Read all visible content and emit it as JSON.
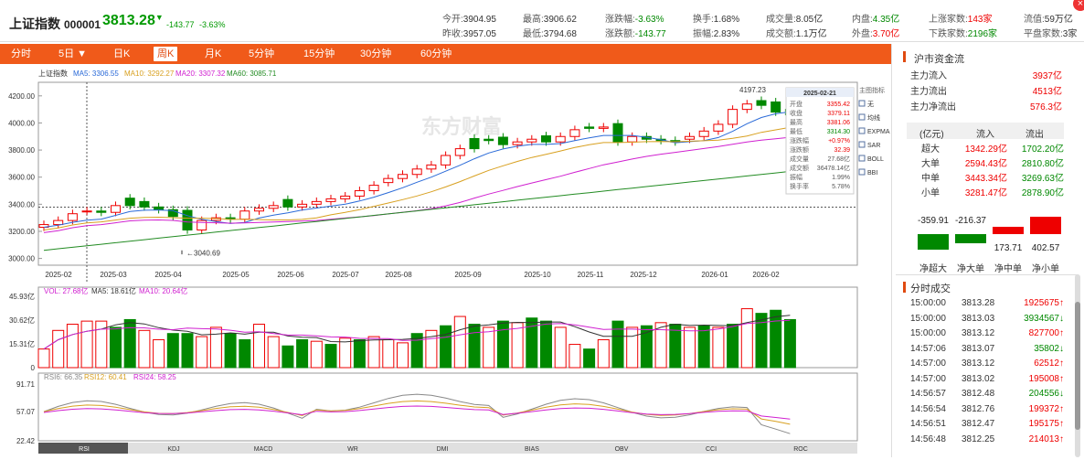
{
  "header": {
    "name": "上证指数",
    "code": "000001",
    "price": "3813.28",
    "arrow": "▼",
    "change": "-143.77",
    "change_pct": "-3.63%"
  },
  "stats": [
    {
      "k": "今开:",
      "v": "3904.95",
      "c": "nt"
    },
    {
      "k": "最高:",
      "v": "3906.62",
      "c": "nt"
    },
    {
      "k": "涨跌幅:",
      "v": "-3.63%",
      "c": "dn"
    },
    {
      "k": "换手:",
      "v": "1.68%",
      "c": "nt"
    },
    {
      "k": "成交量:",
      "v": "8.05亿",
      "c": "nt"
    },
    {
      "k": "内盘:",
      "v": "4.35亿",
      "c": "dn"
    },
    {
      "k": "上涨家数:",
      "v": "143家",
      "c": "up"
    },
    {
      "k": "流值:",
      "v": "59万亿",
      "c": "nt"
    },
    {
      "k": "昨收:",
      "v": "3957.05",
      "c": "nt"
    },
    {
      "k": "最低:",
      "v": "3794.68",
      "c": "nt"
    },
    {
      "k": "涨跌额:",
      "v": "-143.77",
      "c": "dn"
    },
    {
      "k": "振幅:",
      "v": "2.83%",
      "c": "nt"
    },
    {
      "k": "成交额:",
      "v": "1.1万亿",
      "c": "nt"
    },
    {
      "k": "外盘:",
      "v": "3.70亿",
      "c": "up"
    },
    {
      "k": "下跌家数:",
      "v": "2196家",
      "c": "dn"
    },
    {
      "k": "平盘家数:",
      "v": "3家",
      "c": "nt"
    }
  ],
  "tabs": [
    "分时",
    "5日 ▼",
    "日K",
    "周K",
    "月K",
    "5分钟",
    "15分钟",
    "30分钟",
    "60分钟"
  ],
  "active_tab": "周K",
  "chart_data": [
    {
      "type": "candlestick",
      "legend": {
        "name": "上证指数",
        "ma5": "MA5: 3306.55",
        "ma10": "MA10: 3292.27",
        "ma20": "MA20: 3307.32",
        "ma60": "MA60: 3085.71"
      },
      "yticks": [
        "4200.00",
        "4000.00",
        "3800.00",
        "3600.00",
        "3400.00",
        "3200.00",
        "3000.00"
      ],
      "xticks": [
        "2025-02",
        "2025-03",
        "2025-04",
        "2025-05",
        "2025-06",
        "2025-07",
        "2025-08",
        "2025-09",
        "2025-10",
        "2025-11",
        "2025-12",
        "2026-01",
        "2026-02"
      ],
      "high_label": "4197.23",
      "low_label": "3040.69",
      "indicator_menu": [
        "主图指标",
        "无",
        "均线",
        "EXPMA",
        "SAR",
        "BOLL",
        "BBI"
      ],
      "tooltip": {
        "date": "2025-02-21",
        "rows": [
          [
            "开盘",
            "3355.42",
            "up"
          ],
          [
            "收盘",
            "3379.11",
            "up"
          ],
          [
            "最高",
            "3381.06",
            "up"
          ],
          [
            "最低",
            "3314.30",
            "dn"
          ],
          [
            "涨跌幅",
            "+0.97%",
            "up"
          ],
          [
            "涨跌额",
            "32.39",
            "up"
          ],
          [
            "成交量",
            "27.68亿",
            "nt"
          ],
          [
            "成交额",
            "36478.14亿",
            "nt"
          ],
          [
            "振幅",
            "1.99%",
            "nt"
          ],
          [
            "换手率",
            "5.78%",
            "nt"
          ]
        ]
      }
    },
    {
      "type": "bar",
      "legend": {
        "vol": "VOL: 27.68亿",
        "ma5": "MA5: 18.61亿",
        "ma10": "MA10: 20.64亿"
      },
      "yticks": [
        "45.93亿",
        "30.62亿",
        "15.31亿",
        "0"
      ]
    },
    {
      "type": "line",
      "legend": {
        "rsi6": "RSI6: 66.35",
        "rsi12": "RSI12: 60.41",
        "rsi24": "RSI24: 58.25"
      },
      "yticks": [
        "91.71",
        "57.07",
        "22.42"
      ],
      "indicator_tabs": [
        "RSI",
        "KDJ",
        "MACD",
        "WR",
        "DMI",
        "BIAS",
        "OBV",
        "CCI",
        "ROC"
      ]
    }
  ],
  "watermark": "东方财富",
  "side": {
    "title": "沪市资金流",
    "flows": [
      {
        "l": "主力流入",
        "v": "3937亿"
      },
      {
        "l": "主力流出",
        "v": "4513亿"
      },
      {
        "l": "主力净流出",
        "v": "576.3亿"
      }
    ],
    "table_head": [
      "(亿元)",
      "流入",
      "流出"
    ],
    "table": [
      [
        "超大",
        "1342.29亿",
        "1702.20亿"
      ],
      [
        "大单",
        "2594.43亿",
        "2810.80亿"
      ],
      [
        "中单",
        "3443.34亿",
        "3269.63亿"
      ],
      [
        "小单",
        "3281.47亿",
        "2878.90亿"
      ]
    ],
    "net": [
      {
        "l": "净超大",
        "v": "-359.91",
        "c": "dn",
        "val": -359.91
      },
      {
        "l": "净大单",
        "v": "-216.37",
        "c": "dn",
        "val": -216.37
      },
      {
        "l": "净中单",
        "v": "173.71",
        "c": "up",
        "val": 173.71
      },
      {
        "l": "净小单",
        "v": "402.57",
        "c": "up",
        "val": 402.57
      }
    ],
    "ticks_title": "分时成交",
    "ticks": [
      [
        "15:00:00",
        "3813.28",
        "1925675",
        "↑",
        "up"
      ],
      [
        "15:00:00",
        "3813.03",
        "3934567",
        "↓",
        "dn"
      ],
      [
        "15:00:00",
        "3813.12",
        "827700",
        "↑",
        "up"
      ],
      [
        "14:57:06",
        "3813.07",
        "35802",
        "↓",
        "dn"
      ],
      [
        "14:57:00",
        "3813.12",
        "62512",
        "↑",
        "up"
      ],
      [
        "14:57:00",
        "3813.02",
        "195008",
        "↑",
        "up"
      ],
      [
        "14:56:57",
        "3812.48",
        "204556",
        "↓",
        "dn"
      ],
      [
        "14:56:54",
        "3812.76",
        "199372",
        "↑",
        "up"
      ],
      [
        "14:56:51",
        "3812.47",
        "195175",
        "↑",
        "up"
      ],
      [
        "14:56:48",
        "3812.25",
        "214013",
        "↑",
        "up"
      ]
    ]
  }
}
